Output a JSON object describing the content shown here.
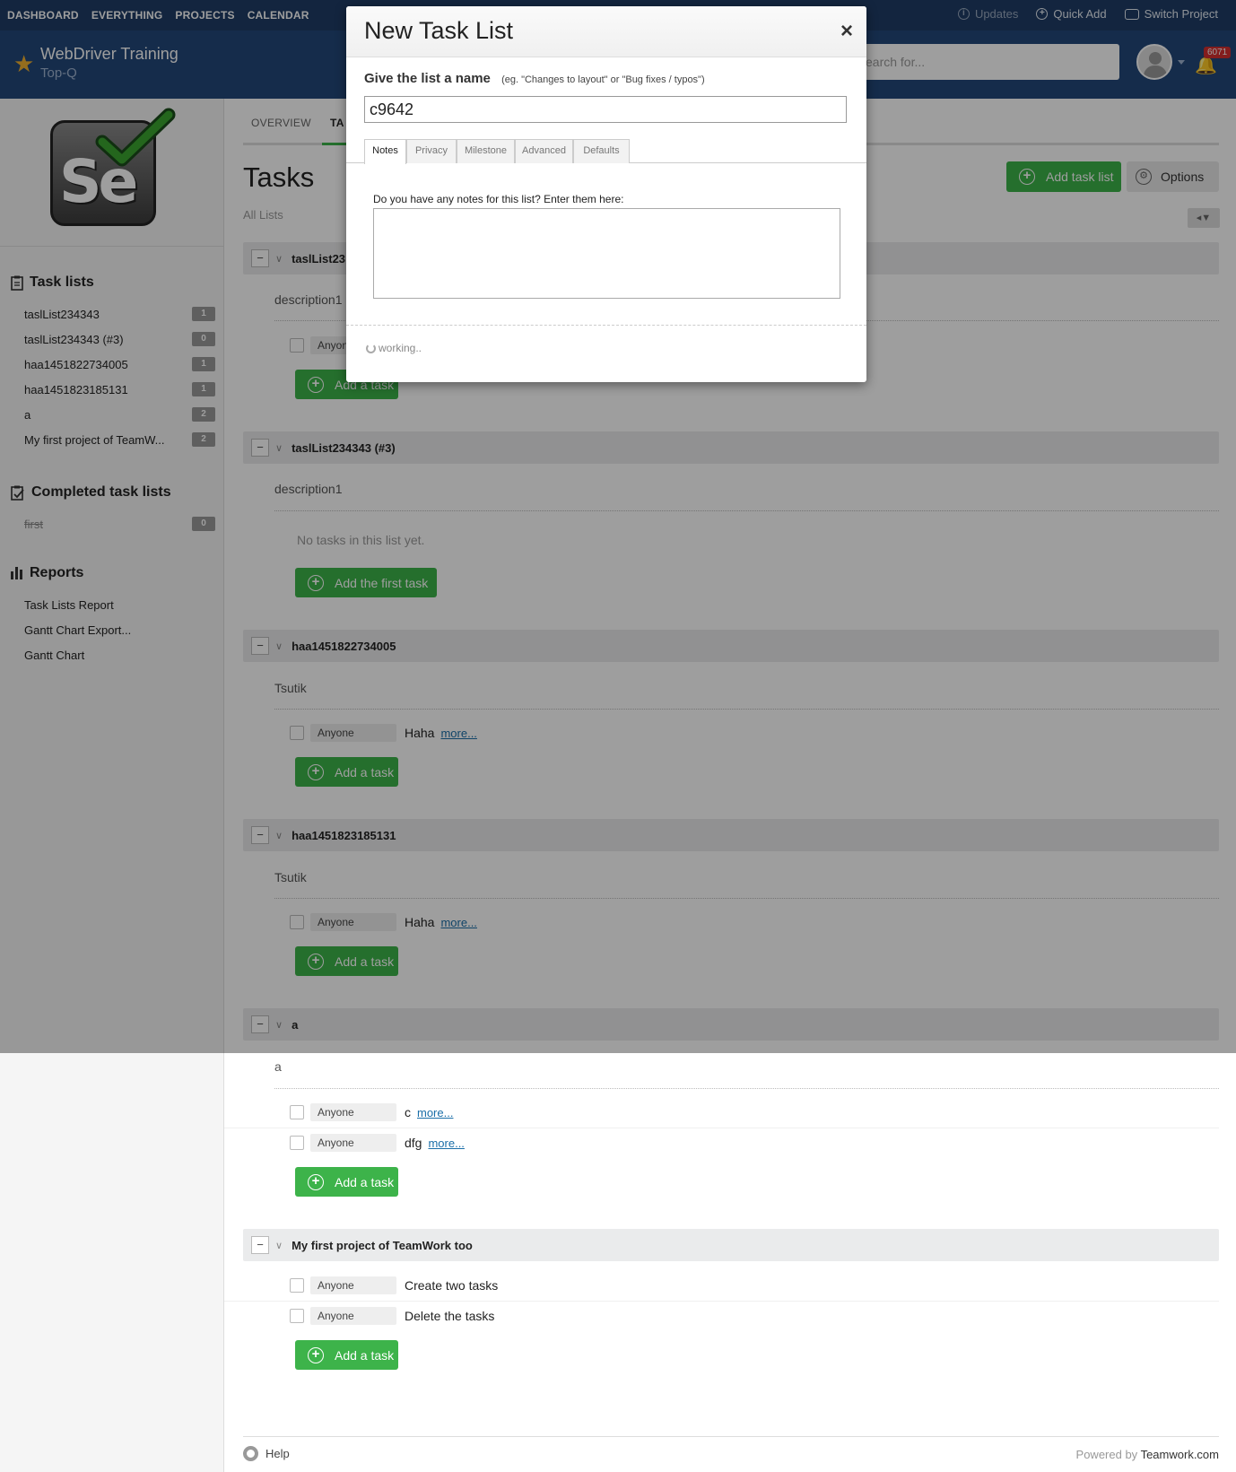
{
  "topnav": {
    "items": [
      "DASHBOARD",
      "EVERYTHING",
      "PROJECTS",
      "CALENDAR"
    ],
    "updates": "Updates",
    "quick_add": "Quick Add",
    "switch_project": "Switch Project"
  },
  "project": {
    "name": "WebDriver Training",
    "company": "Top-Q",
    "search_placeholder": "Search for...",
    "search_visible": "earch for...",
    "notification_count": "6071"
  },
  "sidebar": {
    "task_lists_heading": "Task lists",
    "task_lists": [
      {
        "label": "taslList234343",
        "count": "1"
      },
      {
        "label": "taslList234343 (#3)",
        "count": "0"
      },
      {
        "label": "haa1451822734005",
        "count": "1"
      },
      {
        "label": "haa1451823185131",
        "count": "1"
      },
      {
        "label": "a",
        "count": "2"
      },
      {
        "label": "My first project of TeamW...",
        "count": "2"
      }
    ],
    "completed_heading": "Completed task lists",
    "completed": [
      {
        "label": "first",
        "count": "0"
      }
    ],
    "reports_heading": "Reports",
    "reports": [
      "Task Lists Report",
      "Gantt Chart Export...",
      "Gantt Chart"
    ]
  },
  "main": {
    "tabs": [
      "OVERVIEW",
      "TASKS"
    ],
    "tab_visible": "TA",
    "title": "Tasks",
    "subtitle": "All Lists",
    "add_task_list": "Add task list",
    "options": "Options",
    "lists": [
      {
        "title": "taslList23",
        "description": "description1",
        "tasks": [
          {
            "who": "Anyone",
            "name": "",
            "more": ""
          }
        ],
        "add": "Add a task"
      },
      {
        "title": "taslList234343 (#3)",
        "description": "description1",
        "empty": "No tasks in this list yet.",
        "add": "Add the first task"
      },
      {
        "title": "haa1451822734005",
        "description": "Tsutik",
        "tasks": [
          {
            "who": "Anyone",
            "name": "Haha",
            "more": "more..."
          }
        ],
        "add": "Add a task"
      },
      {
        "title": "haa1451823185131",
        "description": "Tsutik",
        "tasks": [
          {
            "who": "Anyone",
            "name": "Haha",
            "more": "more..."
          }
        ],
        "add": "Add a task"
      },
      {
        "title": "a",
        "description": "a",
        "tasks": [
          {
            "who": "Anyone",
            "name": "c",
            "more": "more..."
          },
          {
            "who": "Anyone",
            "name": "dfg",
            "more": "more..."
          }
        ],
        "add": "Add a task"
      },
      {
        "title": "My first project of TeamWork too",
        "tasks": [
          {
            "who": "Anyone",
            "name": "Create two tasks"
          },
          {
            "who": "Anyone",
            "name": "Delete the tasks"
          }
        ],
        "add": "Add a task"
      }
    ]
  },
  "footer": {
    "help": "Help",
    "powered_prefix": "Powered by",
    "powered_brand": "Teamwork.com"
  },
  "modal": {
    "title": "New Task List",
    "close": "×",
    "name_label": "Give the list a name",
    "name_hint": "(eg. \"Changes to layout\" or \"Bug fixes / typos\")",
    "name_value": "c9642",
    "tabs": [
      "Notes",
      "Privacy",
      "Milestone",
      "Advanced",
      "Defaults"
    ],
    "active_tab": "Notes",
    "notes_label": "Do you have any notes for this list? Enter them here:",
    "notes_value": "",
    "status": "working.."
  },
  "colors": {
    "nav": "#1f3d66",
    "header": "#234879",
    "accent_green": "#3db34a",
    "overlay": "rgba(0,0,0,0.38)",
    "badge_red": "#d32f2f"
  }
}
